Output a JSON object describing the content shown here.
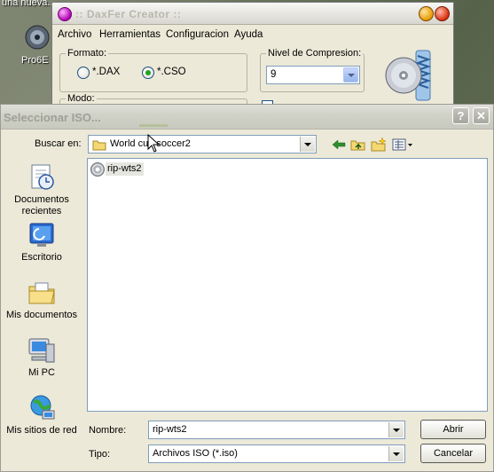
{
  "desktop": {
    "top_caption": "una nueva...",
    "icon_label": "Pro6E"
  },
  "app_window": {
    "title": ":: DaxFer Creator ::",
    "menus": [
      "Archivo",
      "Herramientas",
      "Configuracion",
      "Ayuda"
    ],
    "format_group": {
      "label": "Formato:",
      "options": [
        {
          "label": "*.DAX",
          "checked": false
        },
        {
          "label": "*.CSO",
          "checked": true
        }
      ]
    },
    "compression_group": {
      "label": "Nivel de Compresion:",
      "value": "9"
    },
    "mode_group": {
      "label": "Modo:"
    }
  },
  "dialog": {
    "title": "Seleccionar ISO...",
    "look_in": {
      "label": "Buscar en:",
      "value": "World cup soccer2"
    },
    "toolbar_icons": [
      "back-icon",
      "up-folder-icon",
      "new-folder-icon",
      "view-menu-icon"
    ],
    "places": [
      {
        "label": "Documentos recientes",
        "icon": "recent-documents-icon"
      },
      {
        "label": "Escritorio",
        "icon": "desktop-icon"
      },
      {
        "label": "Mis documentos",
        "icon": "my-documents-icon"
      },
      {
        "label": "Mi PC",
        "icon": "my-computer-icon"
      },
      {
        "label": "Mis sitios de red",
        "icon": "network-places-icon"
      }
    ],
    "files": [
      {
        "name": "rip-wts2",
        "icon": "disc-image-icon",
        "selected": true
      }
    ],
    "filename": {
      "label": "Nombre:",
      "value": "rip-wts2"
    },
    "filetype": {
      "label": "Tipo:",
      "value": "Archivos ISO (*.iso)"
    },
    "buttons": {
      "open": "Abrir",
      "cancel": "Cancelar"
    },
    "title_buttons": {
      "help": "?",
      "close": "✕"
    }
  }
}
